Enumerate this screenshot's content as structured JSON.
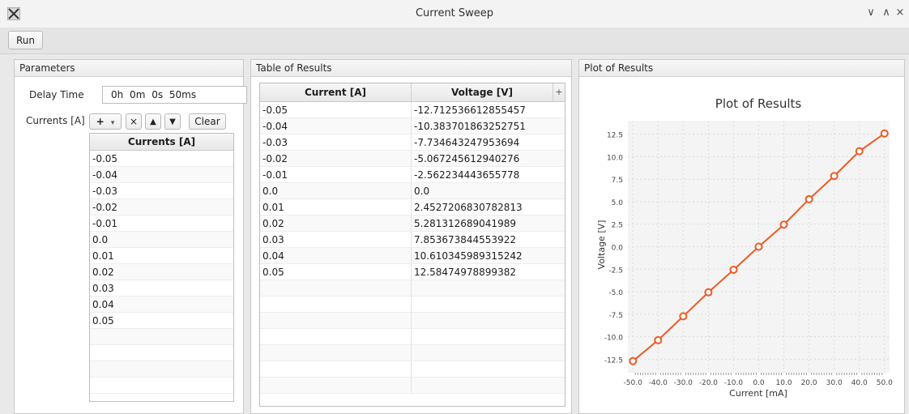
{
  "window": {
    "title": "Current Sweep",
    "controls": [
      "∨",
      "∧",
      "×"
    ]
  },
  "toolbar": {
    "run_label": "Run"
  },
  "parameters": {
    "heading": "Parameters",
    "delay_label": "Delay Time",
    "delay_value": "0h 0m 0s 50ms",
    "currents_label": "Currents [A]",
    "add_label": "+",
    "add_arrow": "▾",
    "remove_label": "×",
    "up_label": "▲",
    "down_label": "▼",
    "clear_label": "Clear",
    "list_header": "Currents [A]",
    "currents": [
      "-0.05",
      "-0.04",
      "-0.03",
      "-0.02",
      "-0.01",
      "0.0",
      "0.01",
      "0.02",
      "0.03",
      "0.04",
      "0.05"
    ]
  },
  "results": {
    "heading": "Table of Results",
    "col1": "Current [A]",
    "col2": "Voltage [V]",
    "col_add": "+",
    "rows": [
      [
        "-0.05",
        "-12.712536612855457"
      ],
      [
        "-0.04",
        "-10.383701863252751"
      ],
      [
        "-0.03",
        "-7.734643247953694"
      ],
      [
        "-0.02",
        "-5.067245612940276"
      ],
      [
        "-0.01",
        "-2.562234443655778"
      ],
      [
        "0.0",
        "0.0"
      ],
      [
        "0.01",
        "2.4527206830782813"
      ],
      [
        "0.02",
        "5.281312689041989"
      ],
      [
        "0.03",
        "7.853673844553922"
      ],
      [
        "0.04",
        "10.610345989315242"
      ],
      [
        "0.05",
        "12.58474978899382"
      ]
    ]
  },
  "plot_panel": {
    "heading": "Plot of Results"
  },
  "chart_data": {
    "type": "line",
    "title": "Plot of Results",
    "xlabel": "Current [mA]",
    "ylabel": "Voltage [V]",
    "xlim": [
      -52,
      52
    ],
    "ylim": [
      -14,
      14
    ],
    "x_ticks": [
      "-50.0",
      "-40.0",
      "-30.0",
      "-20.0",
      "-10.0",
      "0.0",
      "10.0",
      "20.0",
      "30.0",
      "40.0",
      "50.0"
    ],
    "y_ticks": [
      "12.5",
      "10.0",
      "7.5",
      "5.0",
      "2.5",
      "0.0",
      "-2.5",
      "-5.0",
      "-7.5",
      "-10.0",
      "-12.5"
    ],
    "grid": true,
    "color": "#ee5a24",
    "series": [
      {
        "x": [
          -50,
          -40,
          -30,
          -20,
          -10,
          0,
          10,
          20,
          30,
          40,
          50
        ],
        "y": [
          -12.7125,
          -10.3837,
          -7.7346,
          -5.0672,
          -2.5622,
          0.0,
          2.4527,
          5.2813,
          7.8537,
          10.6103,
          12.5847
        ]
      }
    ]
  }
}
